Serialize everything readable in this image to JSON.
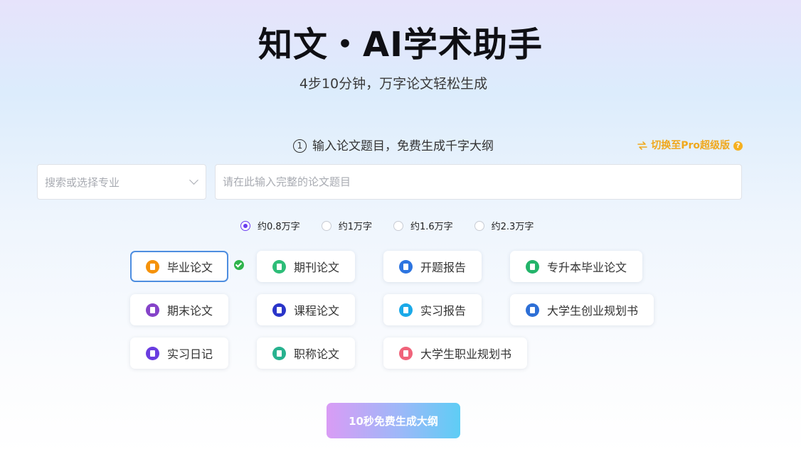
{
  "header": {
    "title": "知文・AI学术助手",
    "subtitle": "4步10分钟，万字论文轻松生成"
  },
  "step": {
    "number": "1",
    "text": "输入论文题目，免费生成千字大纲"
  },
  "pro_switch": {
    "label": "切换至Pro超级版",
    "help": "?"
  },
  "major_select": {
    "placeholder": "搜索或选择专业"
  },
  "title_input": {
    "placeholder": "请在此输入完整的论文题目",
    "value": ""
  },
  "word_counts": [
    {
      "label": "约0.8万字",
      "selected": true
    },
    {
      "label": "约1万字",
      "selected": false
    },
    {
      "label": "约1.6万字",
      "selected": false
    },
    {
      "label": "约2.3万字",
      "selected": false
    }
  ],
  "paper_types": [
    {
      "label": "毕业论文",
      "icon": "book-icon",
      "color": "#f5920a",
      "selected": true
    },
    {
      "label": "期刊论文",
      "icon": "journal-icon",
      "color": "#2dbd78",
      "selected": false
    },
    {
      "label": "开题报告",
      "icon": "save-icon",
      "color": "#2c74e0",
      "selected": false
    },
    {
      "label": "专升本毕业论文",
      "icon": "open-book-icon",
      "color": "#23b46a",
      "selected": false
    },
    {
      "label": "期末论文",
      "icon": "notebook-icon",
      "color": "#8543c9",
      "selected": false
    },
    {
      "label": "课程论文",
      "icon": "course-icon",
      "color": "#2a35c9",
      "selected": false
    },
    {
      "label": "实习报告",
      "icon": "report-icon",
      "color": "#1aa9e8",
      "selected": false
    },
    {
      "label": "大学生创业规划书",
      "icon": "plan-icon",
      "color": "#2d6fd6",
      "selected": false
    },
    {
      "label": "实习日记",
      "icon": "diary-icon",
      "color": "#6a3de0",
      "selected": false
    },
    {
      "label": "职称论文",
      "icon": "certificate-icon",
      "color": "#27b28f",
      "selected": false
    },
    {
      "label": "大学生职业规划书",
      "icon": "career-icon",
      "color": "#f0637a",
      "selected": false
    }
  ],
  "generate_button": {
    "label": "10秒免费生成大纲"
  },
  "colors": {
    "accent": "#6a3cf0",
    "selected_border": "#4e8ee0",
    "pro": "#f0a81c",
    "check": "#2fb44c"
  }
}
